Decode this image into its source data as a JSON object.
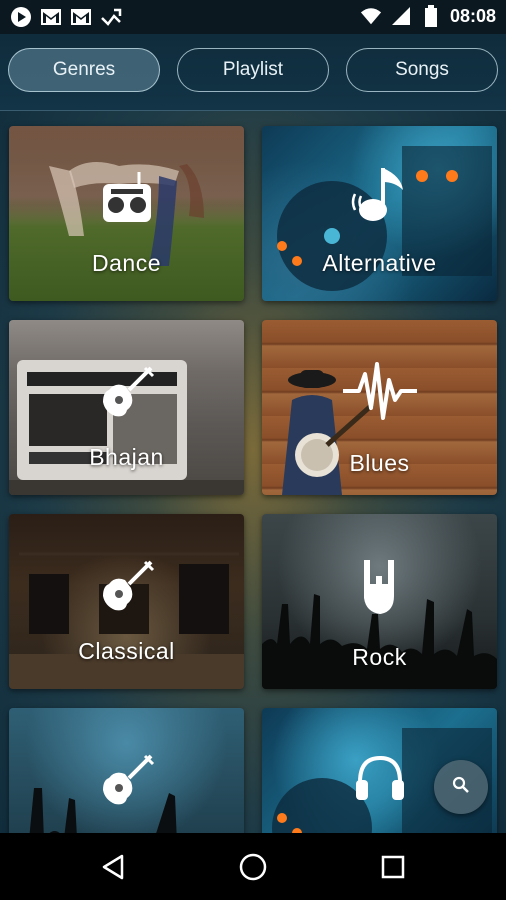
{
  "status_bar": {
    "time": "08:08",
    "left_icons": [
      "play-icon",
      "gmail-icon",
      "gmail-icon",
      "missed-call-icon"
    ],
    "right_icons": [
      "wifi-icon",
      "signal-icon",
      "battery-icon"
    ]
  },
  "tabs": [
    {
      "label": "Genres",
      "active": true
    },
    {
      "label": "Playlist",
      "active": false
    },
    {
      "label": "Songs",
      "active": false
    }
  ],
  "genres": [
    {
      "label": "Dance",
      "icon": "radio-icon"
    },
    {
      "label": "Alternative",
      "icon": "music-note-icon"
    },
    {
      "label": "Bhajan",
      "icon": "guitar-icon"
    },
    {
      "label": "Blues",
      "icon": "waveform-icon"
    },
    {
      "label": "Classical",
      "icon": "guitar-icon"
    },
    {
      "label": "Rock",
      "icon": "rock-hand-icon"
    },
    {
      "label": "",
      "icon": "guitar-icon"
    },
    {
      "label": "",
      "icon": "headphones-icon"
    }
  ],
  "fab": {
    "icon": "search-icon"
  },
  "nav_bar": {
    "icons": [
      "back-icon",
      "home-icon",
      "recent-apps-icon"
    ]
  },
  "colors": {
    "tab_active_bg": "#5f8799",
    "nav_bg": "#000000",
    "status_bg": "#0b1820"
  }
}
